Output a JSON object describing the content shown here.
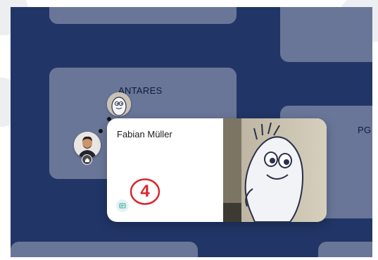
{
  "rooms": {
    "antares_label": "ANTARES",
    "pg_label": "PG"
  },
  "card": {
    "name": "Fabian Müller"
  },
  "annotation": {
    "marker_label": "4",
    "marker_color": "#d8282e"
  },
  "icons": {
    "chat": "chat-icon",
    "home": "home-icon"
  },
  "colors": {
    "map_background": "#213666",
    "room_fill": "#6a7698",
    "card_background": "#ffffff",
    "chat_button_fill": "#e3f3f1"
  }
}
